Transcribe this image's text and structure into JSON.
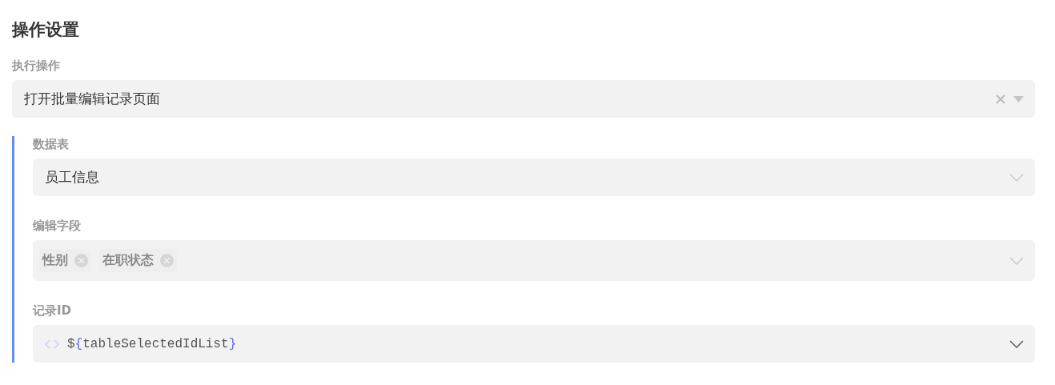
{
  "title": "操作设置",
  "action": {
    "label": "执行操作",
    "value": "打开批量编辑记录页面",
    "clearable": true
  },
  "fields": [
    {
      "kind": "select",
      "label": "数据表",
      "value": "员工信息"
    },
    {
      "kind": "tags",
      "label": "编辑字段",
      "tags": [
        "性别",
        "在职状态"
      ]
    },
    {
      "kind": "expression",
      "label": "记录ID",
      "expression": {
        "sigil": "$",
        "open": "{",
        "variable": "tableSelectedIdList",
        "close": "}"
      }
    }
  ]
}
